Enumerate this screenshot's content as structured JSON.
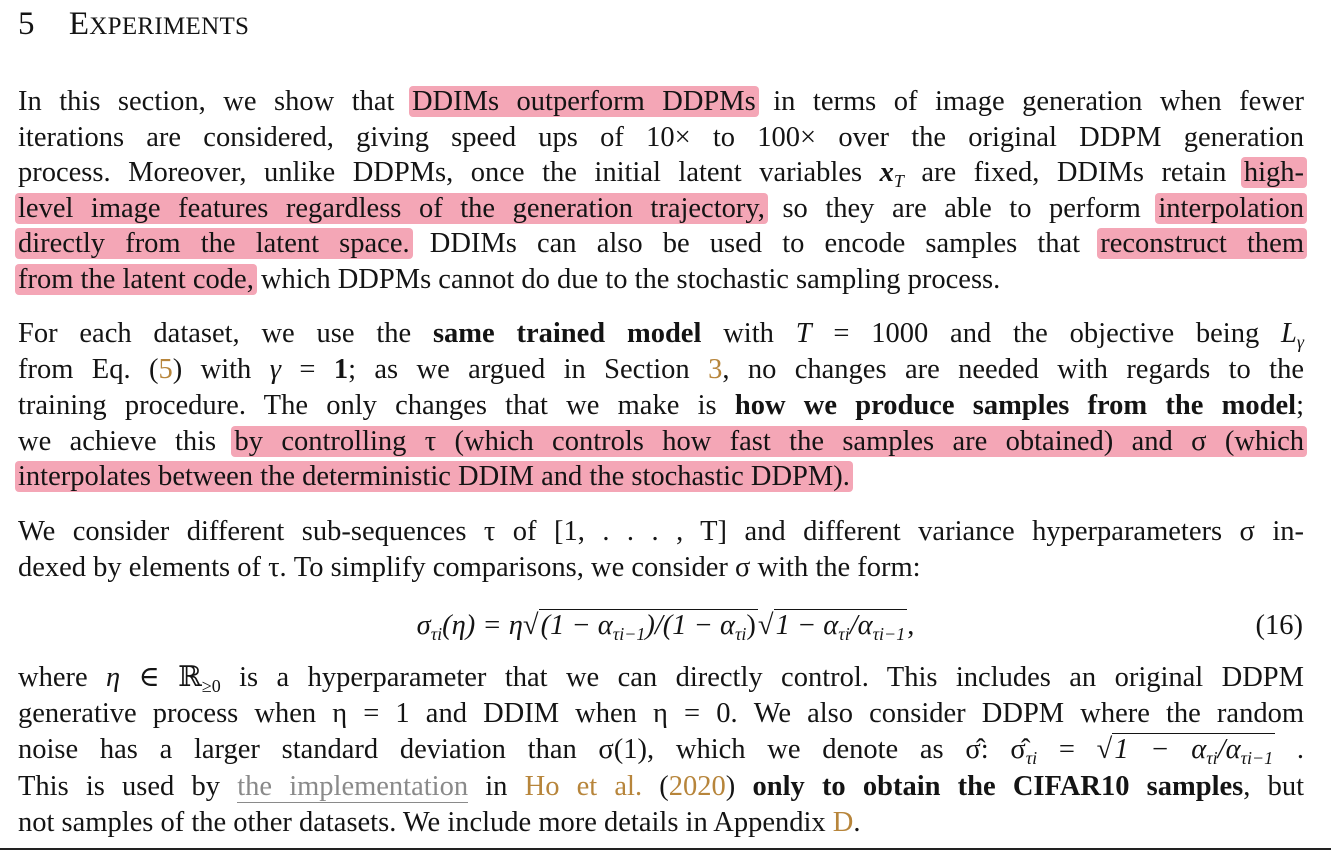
{
  "section": {
    "number": "5",
    "title_initial": "E",
    "title_rest": "XPERIMENTS"
  },
  "p1": {
    "l1": {
      "a": "In this section, we show that ",
      "h": "DDIMs outperform DDPMs",
      "b": " in terms of image generation when fewer"
    },
    "l2": "iterations are considered, giving speed ups of 10× to 100× over the original DDPM generation",
    "l3": {
      "a": "process. Moreover, unlike DDPMs, once the initial latent variables ",
      "m": "x",
      "msub": "T",
      "b": " are fixed, DDIMs retain ",
      "h": "high-"
    },
    "l4": {
      "h1": "level image features regardless of the generation trajectory,",
      "a": " so they are able to perform ",
      "h2": "interpolation"
    },
    "l5": {
      "h1": "directly from the latent space.",
      "a": " DDIMs can also be used to encode samples that ",
      "h2": "reconstruct them"
    },
    "l6": {
      "h": "from the latent code,",
      "a": " which DDPMs cannot do due to the stochastic sampling process."
    }
  },
  "p2": {
    "l1": {
      "a": "For each dataset, we use the ",
      "bold": "same trained model",
      "b": " with ",
      "m1": "T",
      "c": " = 1000 and the objective being ",
      "m2": "L",
      "msub": "γ"
    },
    "l2": {
      "a": "from Eq. (",
      "ref1": "5",
      "b": ") with ",
      "m": "γ",
      "c": " = ",
      "bold": "1",
      "d": "; as we argued in Section ",
      "ref2": "3",
      "e": ", no changes are needed with regards to the"
    },
    "l3": {
      "a": "training procedure. The only changes that we make is ",
      "bold": "how we produce samples from the model",
      "b": ";"
    },
    "l4": {
      "a": "we achieve this ",
      "h": "by controlling τ (which controls how fast the samples are obtained) and σ (which"
    },
    "l5": {
      "h": "interpolates between the deterministic DDIM and the stochastic DDPM)."
    }
  },
  "p3": {
    "l1": "We consider different sub-sequences τ of [1, . . . , T] and different variance hyperparameters σ in-",
    "l2": "dexed by elements of τ. To simplify comparisons, we consider σ with the form:"
  },
  "equation": {
    "lhs": "σ",
    "lhs_sub": "τi",
    "lhs_arg": "(η) = η",
    "sqrt1": "(1 − α",
    "sqrt1_sub": "τi−1",
    "sqrt1_mid": ")/(1 − α",
    "sqrt1_sub2": "τi",
    "sqrt1_end": ")",
    "sqrt2": "1 − α",
    "sqrt2_sub": "τi",
    "sqrt2_mid": "/α",
    "sqrt2_sub2": "τi−1",
    "tail": ",",
    "number": "(16)"
  },
  "p4": {
    "l1": {
      "a": "where ",
      "m": "η",
      "b": " ∈ ℝ",
      "sub": "≥0",
      "c": " is a hyperparameter that we can directly control. This includes an original DDPM"
    },
    "l2": "generative process when η = 1 and DDIM when η = 0. We also consider DDPM where the random",
    "l3": {
      "a": "noise has a larger standard deviation than σ(1), which we denote as σ̂: σ̂",
      "sub1": "τi",
      "b": " = ",
      "sq": "1 − α",
      "sub2": "τi",
      "c": "/α",
      "sub3": "τi−1",
      "d": " ."
    },
    "l4": {
      "a": "This is used by ",
      "link": "the implementation",
      "b": " in ",
      "cite1": "Ho et al.",
      "c": " (",
      "cite2": "2020",
      "d": ") ",
      "bold": "only to obtain the CIFAR10 samples",
      "e": ", but"
    },
    "l5": {
      "a": "not samples of the other datasets. We include more details in Appendix ",
      "ref": "D",
      "b": "."
    }
  },
  "colors": {
    "highlight": "#f4a6b6",
    "citation": "#b7853b",
    "link": "#8a8a8a"
  }
}
